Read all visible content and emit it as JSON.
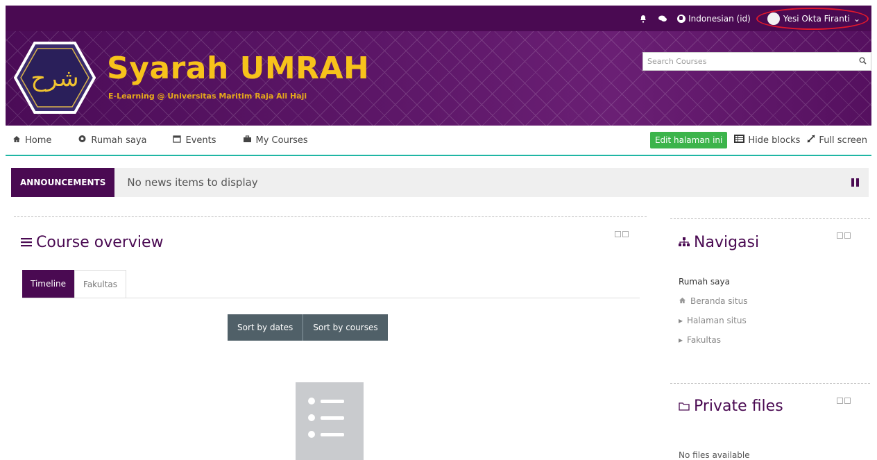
{
  "topbar": {
    "language": "Indonesian (id)",
    "user_name": "Yesi Okta Firanti",
    "icons": [
      "bell-icon",
      "chat-icon",
      "globe-icon",
      "avatar",
      "caret-down-icon"
    ]
  },
  "banner": {
    "title": "Syarah UMRAH",
    "subtitle": "E-Learning @ Universitas Maritim Raja Ali Haji",
    "search_placeholder": "Search Courses"
  },
  "nav": {
    "items": [
      "Home",
      "Rumah saya",
      "Events",
      "My Courses"
    ],
    "edit_button": "Edit halaman ini",
    "hide_blocks": "Hide blocks",
    "full_screen": "Full screen"
  },
  "announcements": {
    "label": "ANNOUNCEMENTS",
    "text": "No news items to display"
  },
  "course_overview": {
    "title": "Course overview",
    "tabs": [
      "Timeline",
      "Fakultas"
    ],
    "active_tab": "Timeline",
    "sort_buttons": [
      "Sort by dates",
      "Sort by courses"
    ]
  },
  "navigasi": {
    "title": "Navigasi",
    "items": [
      {
        "label": "Rumah saya",
        "icon": ""
      },
      {
        "label": "Beranda situs",
        "icon": "home-icon"
      },
      {
        "label": "Halaman situs",
        "icon": "caret-right-icon"
      },
      {
        "label": "Fakultas",
        "icon": "caret-right-icon"
      }
    ]
  },
  "private_files": {
    "title": "Private files",
    "empty_text": "No files available"
  },
  "colors": {
    "primary": "#4a0a52",
    "accent_gold": "#f7c21b",
    "edit_green": "#3cb44b",
    "nav_border": "#1fb6a4",
    "sort_btn": "#506068"
  }
}
